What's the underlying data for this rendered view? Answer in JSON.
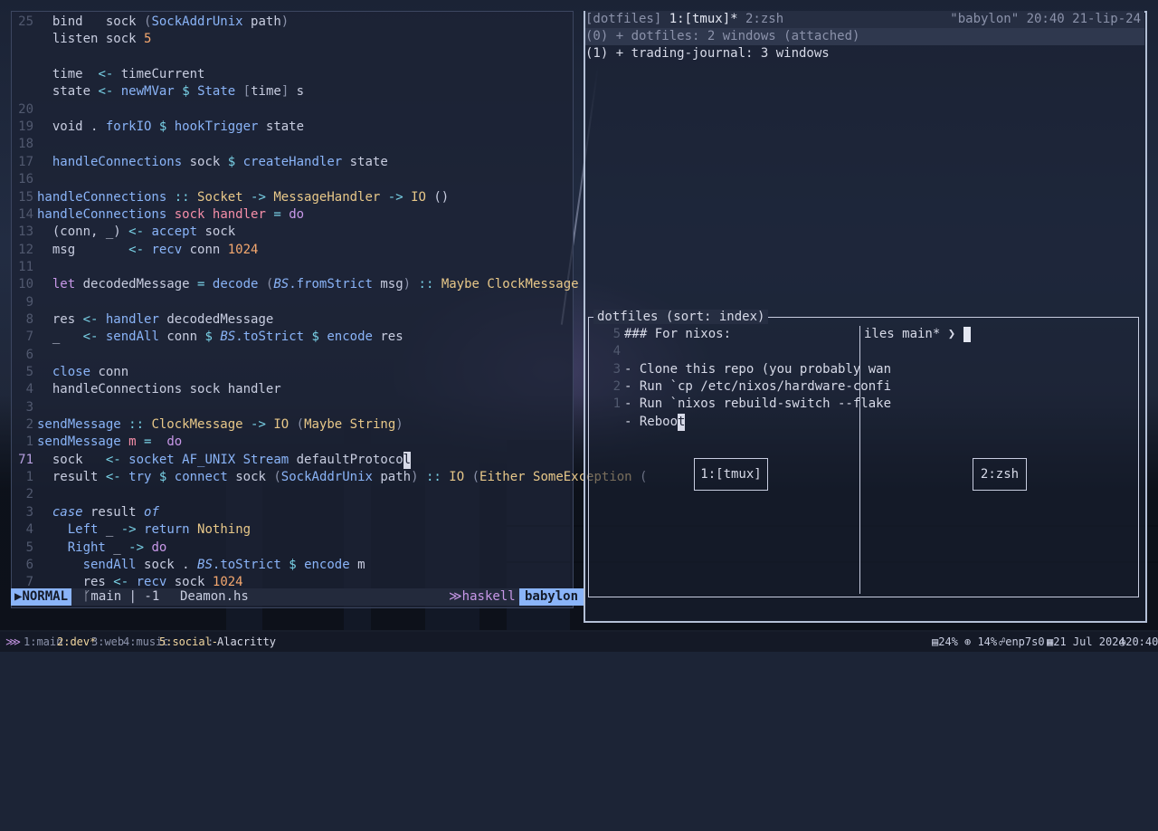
{
  "editor": {
    "lines": [
      {
        "n": "25",
        "segs": [
          [
            "  ",
            ""
          ],
          [
            "bind",
            "c-var"
          ],
          [
            "   sock ",
            ""
          ],
          [
            "(",
            "c-dim"
          ],
          [
            "SockAddrUnix",
            "c-fn"
          ],
          [
            " path",
            ""
          ],
          [
            ")",
            "c-dim"
          ]
        ]
      },
      {
        "n": "",
        "segs": [
          [
            "  listen sock ",
            ""
          ],
          [
            "5",
            "c-num"
          ]
        ]
      },
      {
        "n": "",
        "segs": []
      },
      {
        "n": "",
        "segs": [
          [
            "  time  ",
            ""
          ],
          [
            "<-",
            "c-op"
          ],
          [
            " timeCurrent",
            ""
          ]
        ]
      },
      {
        "n": "",
        "segs": [
          [
            "  state ",
            ""
          ],
          [
            "<-",
            "c-op"
          ],
          [
            " ",
            ""
          ],
          [
            "newMVar",
            "c-fn"
          ],
          [
            " ",
            ""
          ],
          [
            "$",
            "c-op"
          ],
          [
            " ",
            ""
          ],
          [
            "State",
            "c-fn"
          ],
          [
            " ",
            ""
          ],
          [
            "[",
            "c-dim"
          ],
          [
            "time",
            ""
          ],
          [
            "]",
            "c-dim"
          ],
          [
            " s",
            ""
          ]
        ]
      },
      {
        "n": "20",
        "segs": []
      },
      {
        "n": "19",
        "segs": [
          [
            "  void . ",
            ""
          ],
          [
            "forkIO",
            "c-fn"
          ],
          [
            " ",
            ""
          ],
          [
            "$",
            "c-op"
          ],
          [
            " ",
            ""
          ],
          [
            "hookTrigger",
            "c-fn"
          ],
          [
            " state",
            ""
          ]
        ]
      },
      {
        "n": "18",
        "segs": []
      },
      {
        "n": "17",
        "segs": [
          [
            "  ",
            ""
          ],
          [
            "handleConnections",
            "c-fn"
          ],
          [
            " sock ",
            ""
          ],
          [
            "$",
            "c-op"
          ],
          [
            " ",
            ""
          ],
          [
            "createHandler",
            "c-fn"
          ],
          [
            " state",
            ""
          ]
        ]
      },
      {
        "n": "16",
        "segs": []
      },
      {
        "n": "15",
        "segs": [
          [
            "handleConnections",
            "c-fn"
          ],
          [
            " ",
            ""
          ],
          [
            "::",
            "c-op"
          ],
          [
            " ",
            ""
          ],
          [
            "Socket",
            "c-ty"
          ],
          [
            " ",
            ""
          ],
          [
            "->",
            "c-op"
          ],
          [
            " ",
            ""
          ],
          [
            "MessageHandler",
            "c-ty"
          ],
          [
            " ",
            ""
          ],
          [
            "->",
            "c-op"
          ],
          [
            " ",
            ""
          ],
          [
            "IO",
            "c-ty"
          ],
          [
            " ()",
            ""
          ]
        ]
      },
      {
        "n": "14",
        "segs": [
          [
            "handleConnections",
            "c-fn"
          ],
          [
            " ",
            ""
          ],
          [
            "sock",
            "c-red"
          ],
          [
            " ",
            ""
          ],
          [
            "handler",
            "c-red"
          ],
          [
            " ",
            ""
          ],
          [
            "=",
            "c-op"
          ],
          [
            " ",
            ""
          ],
          [
            "do",
            "c-kw"
          ]
        ]
      },
      {
        "n": "13",
        "segs": [
          [
            "  (conn, _) ",
            ""
          ],
          [
            "<-",
            "c-op"
          ],
          [
            " ",
            ""
          ],
          [
            "accept",
            "c-fn"
          ],
          [
            " sock",
            ""
          ]
        ]
      },
      {
        "n": "12",
        "segs": [
          [
            "  msg       ",
            ""
          ],
          [
            "<-",
            "c-op"
          ],
          [
            " ",
            ""
          ],
          [
            "recv",
            "c-fn"
          ],
          [
            " conn ",
            ""
          ],
          [
            "1024",
            "c-num"
          ]
        ]
      },
      {
        "n": "11",
        "segs": []
      },
      {
        "n": "10",
        "segs": [
          [
            "  ",
            ""
          ],
          [
            "let",
            "c-kw"
          ],
          [
            " decodedMessage ",
            ""
          ],
          [
            "=",
            "c-op"
          ],
          [
            " ",
            ""
          ],
          [
            "decode",
            "c-fn"
          ],
          [
            " ",
            ""
          ],
          [
            "(",
            "c-dim"
          ],
          [
            "BS",
            "c-it"
          ],
          [
            ".fromStrict",
            "c-fn"
          ],
          [
            " msg",
            ""
          ],
          [
            ")",
            "c-dim"
          ],
          [
            " ",
            ""
          ],
          [
            "::",
            "c-op"
          ],
          [
            " ",
            ""
          ],
          [
            "Maybe",
            "c-ty"
          ],
          [
            " ",
            ""
          ],
          [
            "ClockMessage",
            "c-ty"
          ]
        ]
      },
      {
        "n": "9",
        "segs": []
      },
      {
        "n": "8",
        "segs": [
          [
            "  res ",
            ""
          ],
          [
            "<-",
            "c-op"
          ],
          [
            " ",
            ""
          ],
          [
            "handler",
            "c-fn"
          ],
          [
            " decodedMessage",
            ""
          ]
        ]
      },
      {
        "n": "7",
        "segs": [
          [
            "  _   ",
            ""
          ],
          [
            "<-",
            "c-op"
          ],
          [
            " ",
            ""
          ],
          [
            "sendAll",
            "c-fn"
          ],
          [
            " conn ",
            ""
          ],
          [
            "$",
            "c-op"
          ],
          [
            " ",
            ""
          ],
          [
            "BS",
            "c-it"
          ],
          [
            ".toStrict",
            "c-fn"
          ],
          [
            " ",
            ""
          ],
          [
            "$",
            "c-op"
          ],
          [
            " ",
            ""
          ],
          [
            "encode",
            "c-fn"
          ],
          [
            " res",
            ""
          ]
        ]
      },
      {
        "n": "6",
        "segs": []
      },
      {
        "n": "5",
        "segs": [
          [
            "  ",
            ""
          ],
          [
            "close",
            "c-fn"
          ],
          [
            " conn",
            ""
          ]
        ]
      },
      {
        "n": "4",
        "segs": [
          [
            "  handleConnections sock handler",
            ""
          ]
        ]
      },
      {
        "n": "3",
        "segs": []
      },
      {
        "n": "2",
        "segs": [
          [
            "sendMessage",
            "c-fn"
          ],
          [
            " ",
            ""
          ],
          [
            "::",
            "c-op"
          ],
          [
            " ",
            ""
          ],
          [
            "ClockMessage",
            "c-ty"
          ],
          [
            " ",
            ""
          ],
          [
            "->",
            "c-op"
          ],
          [
            " ",
            ""
          ],
          [
            "IO",
            "c-ty"
          ],
          [
            " ",
            ""
          ],
          [
            "(",
            "c-dim"
          ],
          [
            "Maybe",
            "c-ty"
          ],
          [
            " ",
            ""
          ],
          [
            "String",
            "c-ty"
          ],
          [
            ")",
            "c-dim"
          ]
        ]
      },
      {
        "n": "1",
        "segs": [
          [
            "sendMessage",
            "c-fn"
          ],
          [
            " ",
            ""
          ],
          [
            "m",
            "c-red"
          ],
          [
            " ",
            ""
          ],
          [
            "=",
            "c-op"
          ],
          [
            "  ",
            ""
          ],
          [
            "do",
            "c-kw"
          ]
        ]
      },
      {
        "n": "71",
        "cur": true,
        "segs": [
          [
            "  sock   ",
            ""
          ],
          [
            "<-",
            "c-op"
          ],
          [
            " ",
            ""
          ],
          [
            "socket",
            "c-fn"
          ],
          [
            " ",
            ""
          ],
          [
            "AF_UNIX",
            "c-fn"
          ],
          [
            " ",
            ""
          ],
          [
            "Stream",
            "c-fn"
          ],
          [
            " defaultProtoco",
            ""
          ],
          [
            "l",
            "cursor-block"
          ]
        ]
      },
      {
        "n": "1",
        "segs": [
          [
            "  result ",
            ""
          ],
          [
            "<-",
            "c-op"
          ],
          [
            " ",
            ""
          ],
          [
            "try",
            "c-fn"
          ],
          [
            " ",
            ""
          ],
          [
            "$",
            "c-op"
          ],
          [
            " ",
            ""
          ],
          [
            "connect",
            "c-fn"
          ],
          [
            " sock ",
            ""
          ],
          [
            "(",
            "c-dim"
          ],
          [
            "SockAddrUnix",
            "c-fn"
          ],
          [
            " path",
            ""
          ],
          [
            ")",
            "c-dim"
          ],
          [
            " ",
            ""
          ],
          [
            "::",
            "c-op"
          ],
          [
            " ",
            ""
          ],
          [
            "IO",
            "c-ty"
          ],
          [
            " ",
            ""
          ],
          [
            "(",
            "c-dim"
          ],
          [
            "Either",
            "c-ty"
          ],
          [
            " ",
            ""
          ],
          [
            "SomeException",
            "c-ty"
          ],
          [
            " (",
            ""
          ]
        ]
      },
      {
        "n": "2",
        "segs": []
      },
      {
        "n": "3",
        "segs": [
          [
            "  ",
            ""
          ],
          [
            "case",
            "c-it"
          ],
          [
            " result ",
            ""
          ],
          [
            "of",
            "c-it"
          ]
        ]
      },
      {
        "n": "4",
        "segs": [
          [
            "    ",
            ""
          ],
          [
            "Left",
            "c-fn"
          ],
          [
            " _ ",
            ""
          ],
          [
            "->",
            "c-op"
          ],
          [
            " ",
            ""
          ],
          [
            "return",
            "c-fn"
          ],
          [
            " ",
            ""
          ],
          [
            "Nothing",
            "c-ty"
          ]
        ]
      },
      {
        "n": "5",
        "segs": [
          [
            "    ",
            ""
          ],
          [
            "Right",
            "c-fn"
          ],
          [
            " _ ",
            ""
          ],
          [
            "->",
            "c-op"
          ],
          [
            " ",
            ""
          ],
          [
            "do",
            "c-kw"
          ]
        ]
      },
      {
        "n": "6",
        "segs": [
          [
            "      ",
            ""
          ],
          [
            "sendAll",
            "c-fn"
          ],
          [
            " sock . ",
            ""
          ],
          [
            "BS",
            "c-it"
          ],
          [
            ".toStrict",
            "c-fn"
          ],
          [
            " ",
            ""
          ],
          [
            "$",
            "c-op"
          ],
          [
            " ",
            ""
          ],
          [
            "encode",
            "c-fn"
          ],
          [
            " m",
            ""
          ]
        ]
      },
      {
        "n": "7",
        "segs": [
          [
            "      res ",
            ""
          ],
          [
            "<-",
            "c-op"
          ],
          [
            " ",
            ""
          ],
          [
            "recv",
            "c-fn"
          ],
          [
            " sock ",
            ""
          ],
          [
            "1024",
            "c-num"
          ]
        ]
      }
    ],
    "status": {
      "mode": "NORMAL",
      "branch": "main | -1",
      "file": "Deamon.hs",
      "lang": "haskell",
      "host": "babylon"
    }
  },
  "tmux": {
    "bar_left": "[dotfiles] ",
    "bar_current": "1:[tmux]*",
    "bar_other": " 2:zsh",
    "bar_right": "\"babylon\" 20:40 21-lip-24",
    "sessions": [
      "(0) + dotfiles: 2 windows (attached)",
      "(1) + trading-journal: 3 windows"
    ],
    "preview_title": "dotfiles (sort: index)",
    "preview_lines": [
      {
        "n": "5",
        "t": "### For nixos:"
      },
      {
        "n": "4",
        "t": ""
      },
      {
        "n": "3",
        "t": "- Clone this repo (you probably wan"
      },
      {
        "n": "2",
        "t": "- Run `cp /etc/nixos/hardware-confi"
      },
      {
        "n": "1",
        "t": "- Run `nixos rebuild-switch --flake"
      },
      {
        "n": "",
        "t": "- Reboo"
      }
    ],
    "preview_cursor_char": "t",
    "prompt": "iles main* ❯ ",
    "windows": [
      "1:[tmux]",
      "2:zsh"
    ]
  },
  "sysbar": {
    "workspaces": [
      {
        "label": "1:main",
        "state": "normal"
      },
      {
        "label": "2:dev*",
        "state": "current"
      },
      {
        "label": "3:web",
        "state": "normal"
      },
      {
        "label": "4:music",
        "state": "normal"
      },
      {
        "label": "5:social-",
        "state": "hot"
      },
      {
        "label": ":",
        "state": "normal"
      }
    ],
    "title": "Alacritty",
    "ram": "24%",
    "cpu": "14%",
    "net": "enp7s0",
    "date": "21 Jul 2024",
    "time": "20:40"
  }
}
